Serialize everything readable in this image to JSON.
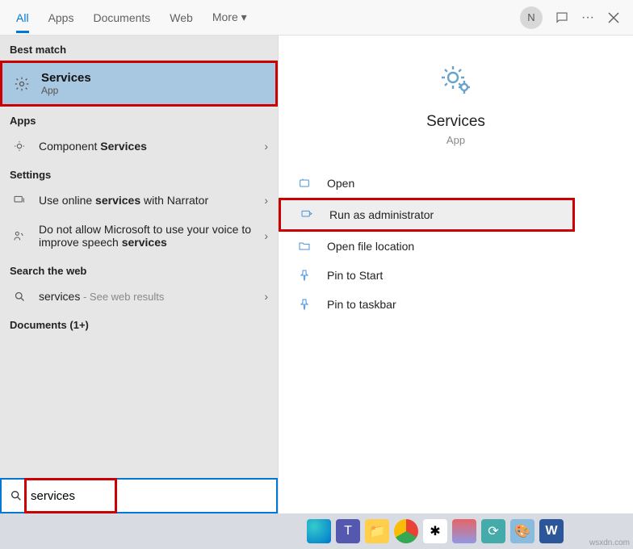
{
  "tabs": {
    "all": "All",
    "apps": "Apps",
    "documents": "Documents",
    "web": "Web",
    "more": "More ▾"
  },
  "user_initial": "N",
  "sections": {
    "best_match": "Best match",
    "apps": "Apps",
    "settings": "Settings",
    "web": "Search the web",
    "docs": "Documents (1+)"
  },
  "best_match": {
    "title": "Services",
    "sub": "App"
  },
  "apps_row": {
    "prefix": "Component ",
    "bold": "Services"
  },
  "settings_rows": {
    "narrator": {
      "p1": "Use online ",
      "b": "services",
      "p2": " with Narrator"
    },
    "speech": {
      "p1": "Do not allow Microsoft to use your voice to improve speech ",
      "b": "services"
    }
  },
  "web_row": {
    "term": "services",
    "suffix": " - See web results"
  },
  "details": {
    "title": "Services",
    "sub": "App"
  },
  "actions": {
    "open": "Open",
    "admin": "Run as administrator",
    "loc": "Open file location",
    "pin_start": "Pin to Start",
    "pin_taskbar": "Pin to taskbar"
  },
  "search": {
    "query": "services"
  },
  "watermark": "wsxdn.com"
}
